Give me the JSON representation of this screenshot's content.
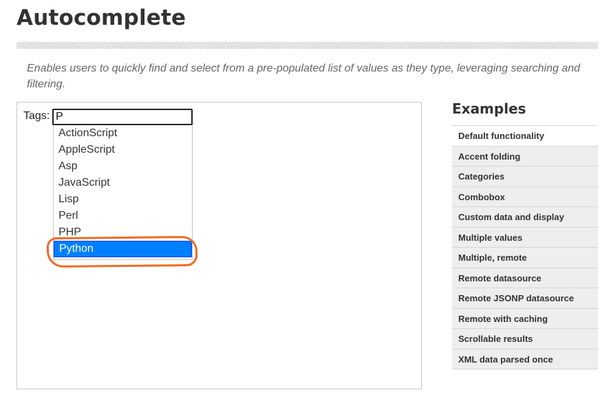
{
  "page": {
    "title": "Autocomplete",
    "description": "Enables users to quickly find and select from a pre-populated list of values as they type, leveraging searching and filtering."
  },
  "demo": {
    "label": "Tags:",
    "input_value": "P",
    "suggestions": [
      {
        "label": "ActionScript"
      },
      {
        "label": "AppleScript"
      },
      {
        "label": "Asp"
      },
      {
        "label": "JavaScript"
      },
      {
        "label": "Lisp"
      },
      {
        "label": "Perl"
      },
      {
        "label": "PHP"
      },
      {
        "label": "Python"
      }
    ],
    "active_index": 7
  },
  "sidebar": {
    "heading": "Examples",
    "items": [
      {
        "label": "Default functionality"
      },
      {
        "label": "Accent folding"
      },
      {
        "label": "Categories"
      },
      {
        "label": "Combobox"
      },
      {
        "label": "Custom data and display"
      },
      {
        "label": "Multiple values"
      },
      {
        "label": "Multiple, remote"
      },
      {
        "label": "Remote datasource"
      },
      {
        "label": "Remote JSONP datasource"
      },
      {
        "label": "Remote with caching"
      },
      {
        "label": "Scrollable results"
      },
      {
        "label": "XML data parsed once"
      }
    ],
    "current_index": 0
  },
  "colors": {
    "active_item_bg": "#007fff",
    "annotation": "#f26a21"
  }
}
